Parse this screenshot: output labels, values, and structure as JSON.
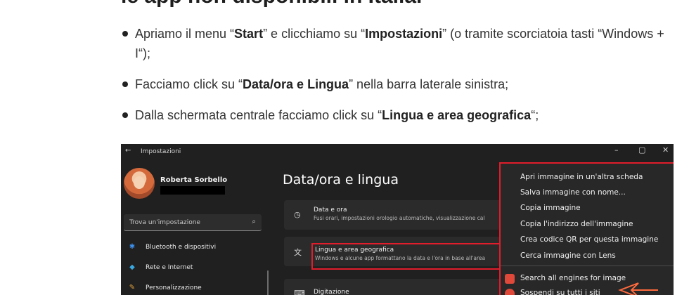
{
  "article": {
    "heading_fragment": "le app non disponibili in Italia.",
    "bullets": [
      {
        "pre": "Apriamo il menu “",
        "b1": "Start",
        "mid": "” e clicchiamo su “",
        "b2": "Impostazioni",
        "post": "” (o tramite scorciatoia tasti “Windows + I“);"
      },
      {
        "pre": "Facciamo click su “",
        "b1": "Data/ora e Lingua",
        "post": "” nella barra laterale sinistra;"
      },
      {
        "pre": "Dalla schermata centrale facciamo click su “",
        "b1": "Lingua e area geografica",
        "post": "“;"
      }
    ]
  },
  "settings": {
    "window_title": "Impostazioni",
    "back_icon": "←",
    "window_controls": [
      "–",
      "▢",
      "✕"
    ],
    "user_name": "Roberta Sorbello",
    "search_placeholder": "Trova un'impostazione",
    "search_icon": "⌕",
    "nav": [
      {
        "label": "Bluetooth e dispositivi",
        "icon": "bluetooth-icon",
        "glyph": "✱",
        "color": "#3b8eea"
      },
      {
        "label": "Rete e Internet",
        "icon": "wifi-icon",
        "glyph": "◆",
        "color": "#39a8e0"
      },
      {
        "label": "Personalizzazione",
        "icon": "brush-icon",
        "glyph": "✎",
        "color": "#e0a040"
      }
    ],
    "page_title": "Data/ora e lingua",
    "cards": [
      {
        "title": "Data e ora",
        "subtitle": "Fusi orari, impostazioni orologio automatiche, visualizzazione cal",
        "icon": "clock-icon",
        "glyph": "◷"
      },
      {
        "title": "Lingua e area geografica",
        "subtitle": "Windows e alcune app formattano la data e l'ora in base all'area",
        "icon": "language-icon",
        "glyph": "文"
      },
      {
        "title": "Digitazione",
        "subtitle": "",
        "icon": "keyboard-icon",
        "glyph": "⌨"
      }
    ]
  },
  "context_menu": {
    "items": [
      "Apri immagine in un'altra scheda",
      "Salva immagine con nome...",
      "Copia immagine",
      "Copia l'indirizzo dell'immagine",
      "Crea codice QR per questa immagine",
      "Cerca immagine con Lens"
    ],
    "extension_items": [
      {
        "label": "Search all engines for image",
        "icon": "camera-icon",
        "color": "#e0483a"
      },
      {
        "label": "Sospendi su tutti i siti",
        "icon": "hand-icon",
        "color": "#e0483a"
      }
    ]
  },
  "colors": {
    "highlight": "#e11d2b",
    "window_bg": "#202020",
    "card_bg": "#2b2b2b"
  }
}
